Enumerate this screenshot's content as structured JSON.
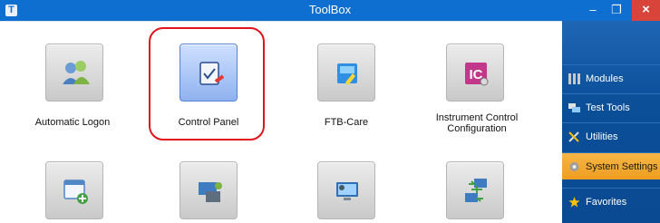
{
  "window": {
    "title": "ToolBox",
    "app_icon_letter": "T",
    "min_glyph": "–",
    "max_glyph": "❐",
    "close_glyph": "×"
  },
  "tiles": [
    {
      "label": "Automatic Logon",
      "icon": "users-icon"
    },
    {
      "label": "Control Panel",
      "icon": "control-panel-icon",
      "selected": true
    },
    {
      "label": "FTB-Care",
      "icon": "ftb-care-icon"
    },
    {
      "label": "Instrument Control\nConfiguration",
      "icon": "instrument-control-icon"
    },
    {
      "label": "",
      "icon": "new-window-icon"
    },
    {
      "label": "",
      "icon": "hardware-icon"
    },
    {
      "label": "",
      "icon": "remote-desktop-icon"
    },
    {
      "label": "",
      "icon": "network-icon"
    }
  ],
  "sidebar": {
    "items": [
      {
        "label": "Modules",
        "icon": "modules-icon"
      },
      {
        "label": "Test Tools",
        "icon": "test-tools-icon"
      },
      {
        "label": "Utilities",
        "icon": "utilities-icon"
      },
      {
        "label": "System Settings",
        "icon": "system-settings-icon",
        "active": true
      },
      {
        "label": "Favorites",
        "icon": "star-icon"
      }
    ]
  },
  "colors": {
    "titlebar": "#0f6fd0",
    "highlight_ring": "#e0141c",
    "sidebar_active": "#f0a52a"
  }
}
